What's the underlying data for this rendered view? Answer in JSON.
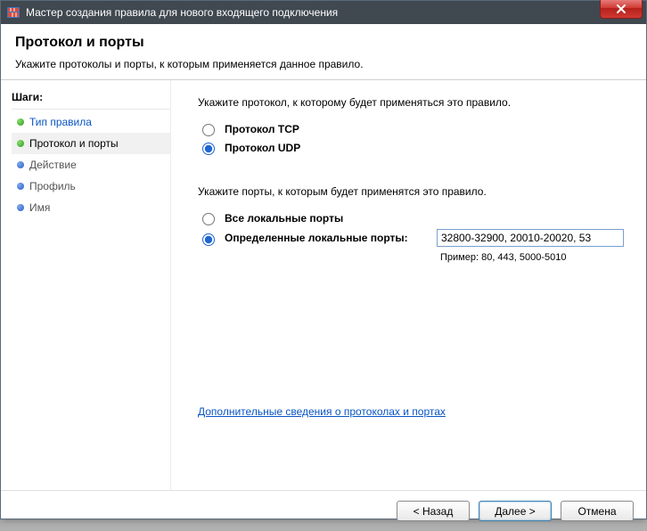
{
  "titlebar": {
    "title": "Мастер создания правила для нового входящего подключения"
  },
  "header": {
    "title": "Протокол и порты",
    "subtitle": "Укажите протоколы и порты, к которым применяется данное правило."
  },
  "sidebar": {
    "steps_label": "Шаги:",
    "steps": [
      {
        "label": "Тип правила",
        "state": "completed"
      },
      {
        "label": "Протокол и порты",
        "state": "current"
      },
      {
        "label": "Действие",
        "state": "upcoming"
      },
      {
        "label": "Профиль",
        "state": "upcoming"
      },
      {
        "label": "Имя",
        "state": "upcoming"
      }
    ]
  },
  "content": {
    "protocol_prompt": "Укажите протокол, к которому будет применяться это правило.",
    "protocol_options": {
      "tcp": {
        "label": "Протокол TCP",
        "checked": false
      },
      "udp": {
        "label": "Протокол UDP",
        "checked": true
      }
    },
    "ports_prompt": "Укажите порты, к которым будет применятся это правило.",
    "ports_options": {
      "all": {
        "label": "Все локальные порты",
        "checked": false
      },
      "specific": {
        "label": "Определенные локальные порты:",
        "checked": true
      }
    },
    "ports_value": "32800-32900, 20010-20020, 53",
    "ports_example": "Пример: 80, 443, 5000-5010",
    "help_link": "Дополнительные сведения о протоколах и портах"
  },
  "footer": {
    "back": "< Назад",
    "next": "Далее >",
    "cancel": "Отмена"
  }
}
